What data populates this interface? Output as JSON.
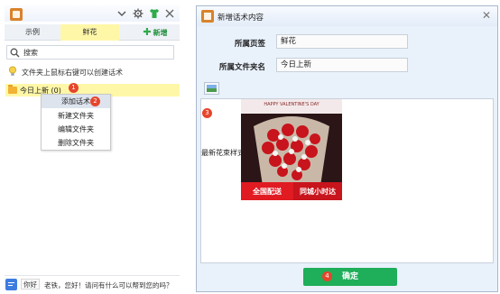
{
  "left_panel": {
    "tabs": [
      "示例",
      "鲜花"
    ],
    "add_tab_label": "新增",
    "search_placeholder": "搜索",
    "hint": "文件夹上鼠标右键可以创建话术",
    "tree_item": "今日上新 (0)",
    "context_menu": [
      "添加话术",
      "新建文件夹",
      "编辑文件夹",
      "删除文件夹"
    ],
    "chat": {
      "greeting": "你好",
      "message": "老铁，您好！请问有什么可以帮到您的吗？"
    }
  },
  "badges": [
    "1",
    "2",
    "3",
    "4"
  ],
  "dialog": {
    "title": "新增话术内容",
    "page_label": "所属页签",
    "page_value": "鲜花",
    "folder_label": "所属文件夹名",
    "folder_value": "今日上新",
    "editor_text": "最新花束样式",
    "image": {
      "headline": "HAPPY VALENTINE'S DAY",
      "banner_left": "全国配送",
      "banner_right": "同城小时达"
    },
    "confirm_label": "确定"
  },
  "colors": {
    "accent_yellow": "#fff7a8",
    "badge_red": "#e6452c",
    "confirm_green": "#1fae5a",
    "add_green": "#1e8f3a"
  }
}
